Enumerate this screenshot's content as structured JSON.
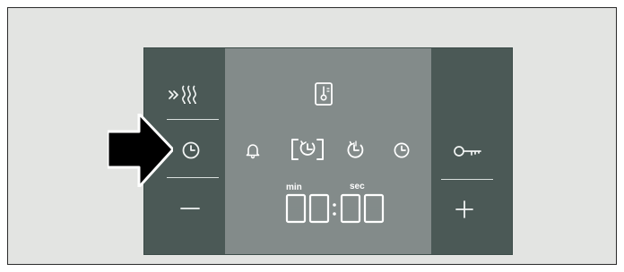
{
  "colors": {
    "background": "#e3e4e2",
    "panel_side": "#4b5956",
    "panel_center": "#838b8a",
    "icon_light": "#f1f4f3",
    "pointer": "#000000"
  },
  "display": {
    "time": "00:00",
    "labels": {
      "min": "min",
      "sec": "sec"
    }
  },
  "icons": {
    "left_top": "fast-preheat-icon",
    "left_middle": "clock-icon",
    "left_bottom": "minus-icon",
    "right_middle": "child-lock-icon",
    "right_bottom": "plus-icon",
    "center_top": "thermometer-icon",
    "center_row": [
      "timer-bell-icon",
      "duration-icon",
      "end-time-icon",
      "time-of-day-icon"
    ],
    "pointer": "pointer-arrow"
  }
}
